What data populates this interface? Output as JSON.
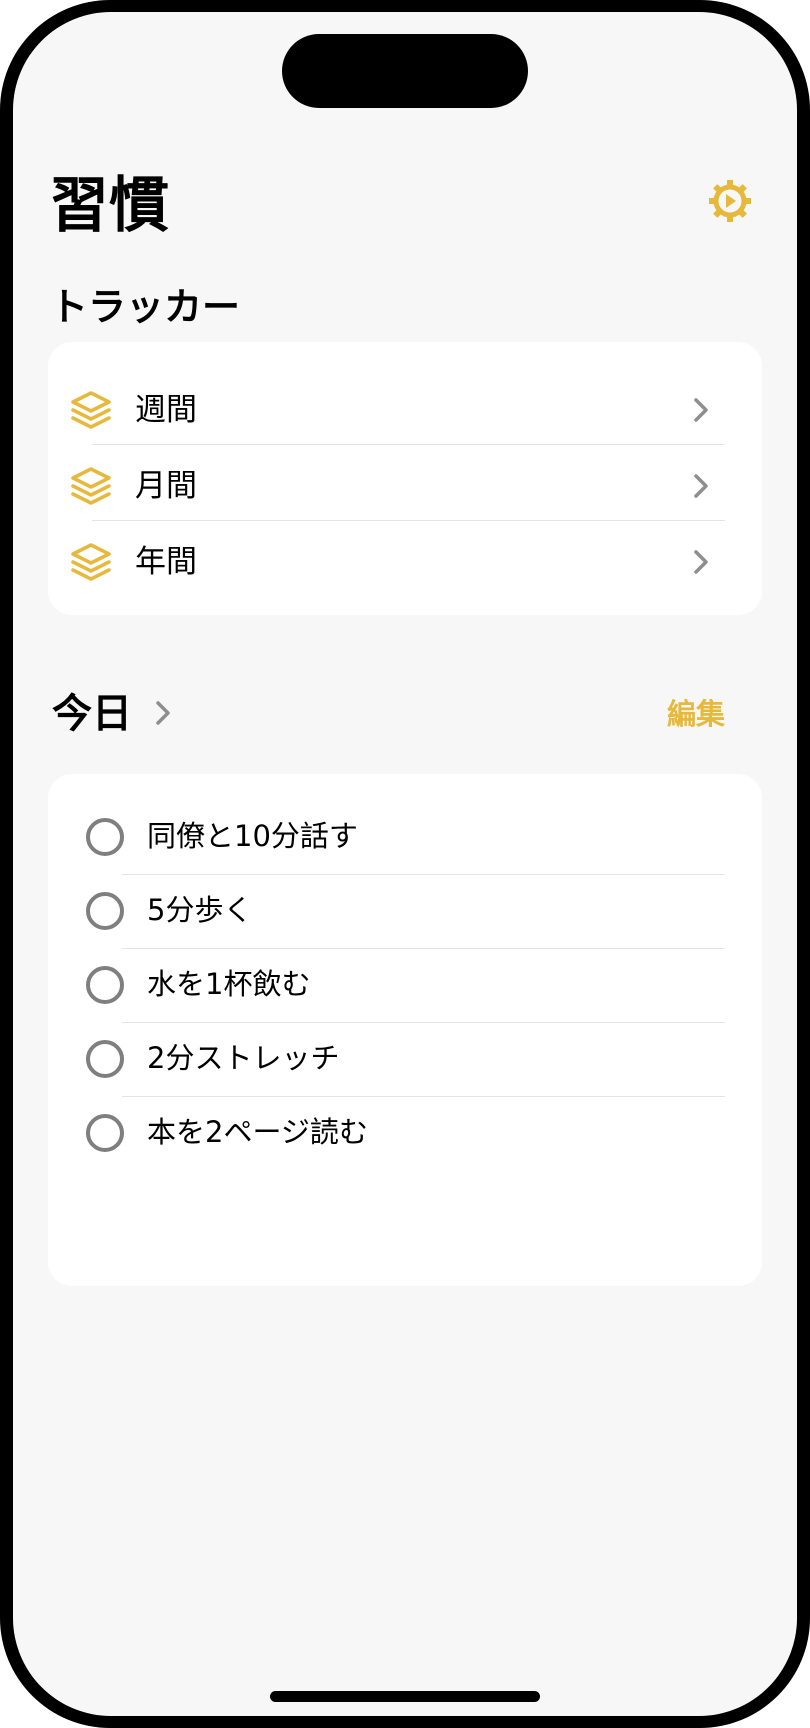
{
  "header": {
    "title": "習慣",
    "settings_icon": "gear-icon"
  },
  "tracker": {
    "section_title": "トラッカー",
    "items": [
      {
        "label": "週間",
        "icon": "layers-icon"
      },
      {
        "label": "月間",
        "icon": "layers-icon"
      },
      {
        "label": "年間",
        "icon": "layers-icon"
      }
    ]
  },
  "today": {
    "title": "今日",
    "edit_label": "編集",
    "habits": [
      {
        "label": "同僚と10分話す"
      },
      {
        "label": "5分歩く"
      },
      {
        "label": "水を1杯飲む"
      },
      {
        "label": "2分ストレッチ"
      },
      {
        "label": "本を2ページ読む"
      }
    ]
  },
  "colors": {
    "accent": "#e6b93d",
    "background": "#f7f7f7",
    "card": "#ffffff",
    "checkbox": "#7f7f7f",
    "chevron": "#8e8e8e"
  }
}
